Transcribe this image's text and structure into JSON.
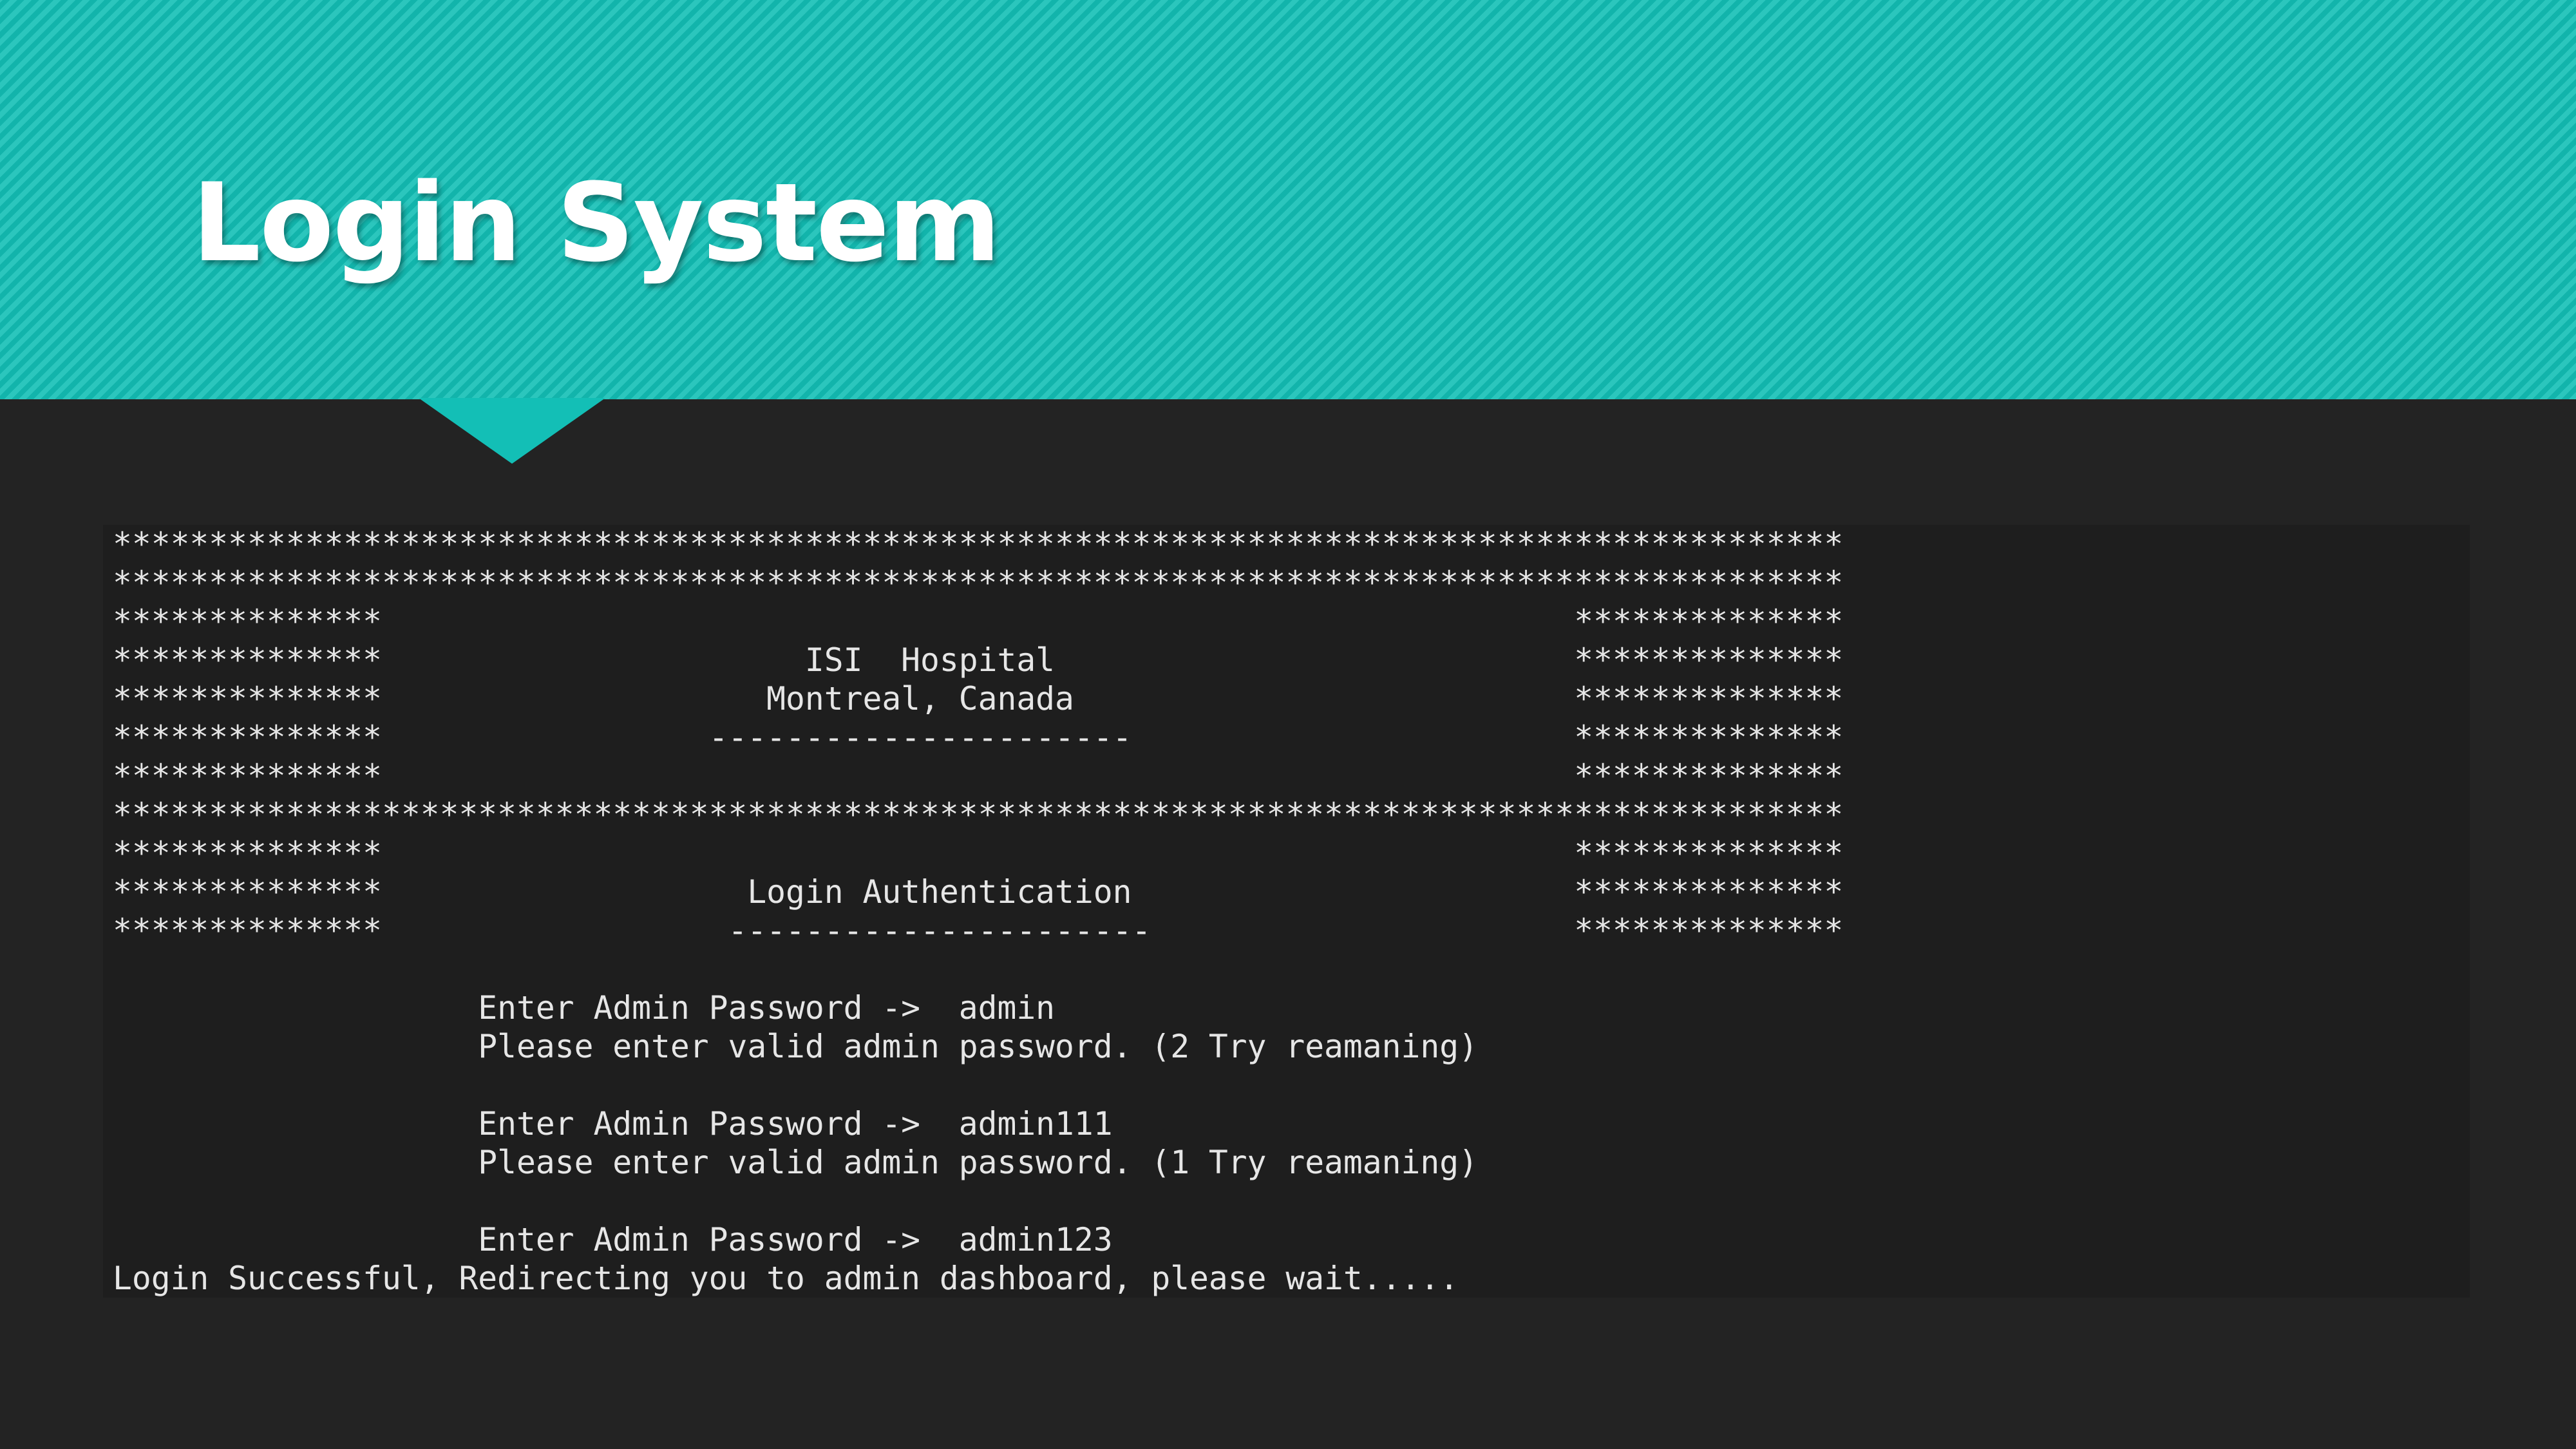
{
  "slide": {
    "title": "Login System"
  },
  "terminal": {
    "lines": [
      "******************************************************************************************",
      "******************************************************************************************",
      "**************                                                              **************",
      "**************                      ISI  Hospital                           **************",
      "**************                    Montreal, Canada                          **************",
      "**************                 ----------------------                       **************",
      "**************                                                              **************",
      "******************************************************************************************",
      "**************                                                              **************",
      "**************                   Login Authentication                       **************",
      "**************                  ----------------------                      **************",
      "",
      "                   Enter Admin Password ->  admin",
      "                   Please enter valid admin password. (2 Try reamaning)",
      "",
      "                   Enter Admin Password ->  admin111",
      "                   Please enter valid admin password. (1 Try reamaning)",
      "",
      "                   Enter Admin Password ->  admin123",
      "Login Successful, Redirecting you to admin dashboard, please wait....."
    ]
  },
  "colors": {
    "header": "#13bfb6",
    "background": "#232323",
    "terminal_bg": "#1e1e1e",
    "terminal_text": "#e6e6e6"
  }
}
